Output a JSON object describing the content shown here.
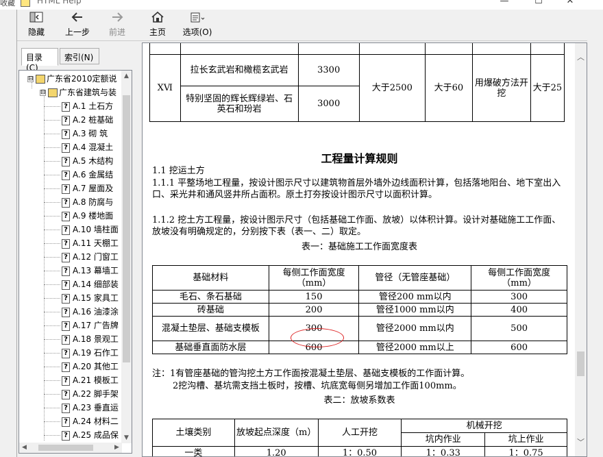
{
  "titlebar": {
    "left_clip": "收藏",
    "title": "HTML Help",
    "minimize": "—",
    "maximize": "☐",
    "close": "✕"
  },
  "toolbar": {
    "hide": {
      "label": "隐藏",
      "icon": "hide-icon"
    },
    "back": {
      "label": "上一步",
      "icon": "back-arrow-icon"
    },
    "forward": {
      "label": "前进",
      "icon": "forward-arrow-icon"
    },
    "home": {
      "label": "主页",
      "icon": "home-icon"
    },
    "options": {
      "label": "选项(O)",
      "icon": "options-icon"
    }
  },
  "nav": {
    "tabs": [
      {
        "label": "目录(C)",
        "active": true
      },
      {
        "label": "索引(N)",
        "active": false
      }
    ],
    "tree": [
      {
        "level": 0,
        "type": "book",
        "expander": "⊟",
        "label": "广东省2010定额说"
      },
      {
        "level": 1,
        "type": "book",
        "expander": "⊟",
        "label": "广东省建筑与装"
      },
      {
        "level": 2,
        "type": "page",
        "label": "A.1 土石方"
      },
      {
        "level": 2,
        "type": "page",
        "label": "A.2 桩基础"
      },
      {
        "level": 2,
        "type": "page",
        "label": "A.3 砌 筑"
      },
      {
        "level": 2,
        "type": "page",
        "label": "A.4 混凝土"
      },
      {
        "level": 2,
        "type": "page",
        "label": "A.5 木结构"
      },
      {
        "level": 2,
        "type": "page",
        "label": "A.6 金属结"
      },
      {
        "level": 2,
        "type": "page",
        "label": "A.7 屋面及"
      },
      {
        "level": 2,
        "type": "page",
        "label": "A.8 防腐与"
      },
      {
        "level": 2,
        "type": "page",
        "label": "A.9 楼地面"
      },
      {
        "level": 2,
        "type": "page",
        "label": "A.10 墙柱面"
      },
      {
        "level": 2,
        "type": "page",
        "label": "A.11 天棚工"
      },
      {
        "level": 2,
        "type": "page",
        "label": "A.12 门窗工"
      },
      {
        "level": 2,
        "type": "page",
        "label": "A.13 幕墙工"
      },
      {
        "level": 2,
        "type": "page",
        "label": "A.14 细部装"
      },
      {
        "level": 2,
        "type": "page",
        "label": "A.15 家具工"
      },
      {
        "level": 2,
        "type": "page",
        "label": "A.16 油漆涂"
      },
      {
        "level": 2,
        "type": "page",
        "label": "A.17 广告牌"
      },
      {
        "level": 2,
        "type": "page",
        "label": "A.18 景观工"
      },
      {
        "level": 2,
        "type": "page",
        "label": "A.19 石作工"
      },
      {
        "level": 2,
        "type": "page",
        "label": "A.20 其他工"
      },
      {
        "level": 2,
        "type": "page",
        "label": "A.21 模板工"
      },
      {
        "level": 2,
        "type": "page",
        "label": "A.22 脚手架"
      },
      {
        "level": 2,
        "type": "page",
        "label": "A.23 垂直运"
      },
      {
        "level": 2,
        "type": "page",
        "label": "A.24 材料二"
      },
      {
        "level": 2,
        "type": "page",
        "label": "A.25 成品保"
      }
    ]
  },
  "content": {
    "top_table": {
      "roman": "ⅩⅥ",
      "rows": [
        {
          "rock": "拉长玄武岩和橄榄玄武岩",
          "value": "3300"
        },
        {
          "rock": "特别坚固的辉长辉绿岩、石英石和玢岩",
          "value": "3000"
        }
      ],
      "col_4": "大于2500",
      "col_5": "大于60",
      "col_6": "用爆破方法开挖",
      "col_7": "大于25"
    },
    "heading": "工程量计算规则",
    "para_1_1": "1.1  挖运土方",
    "para_1_1_1": "1.1.1  平整场地工程量，按设计图示尺寸以建筑物首层外墙外边线面积计算，包括落地阳台、地下室出入口、采光井和通风竖井所占面积。原土打夯按设计图示尺寸以面积计算。",
    "para_1_1_2": "1.1.2  挖土方工程量，按设计图示尺寸（包括基础工作面、放坡）以体积计算。设计对基础施工工作面、放坡没有明确规定的，分别按下表（表一、二）取定。",
    "table1": {
      "caption": "表一：基础施工工作面宽度表",
      "headers": [
        "基础材料",
        "每侧工作面宽度（mm）",
        "管径（无管座基础）",
        "每侧工作面宽度（mm）"
      ],
      "rows": [
        [
          "毛石、条石基础",
          "150",
          "管径200 mm以内",
          "300"
        ],
        [
          "砖基础",
          "200",
          "管径1000 mm以内",
          "400"
        ],
        [
          "混凝土垫层、基础支模板",
          "300",
          "管径2000 mm以内",
          "500"
        ],
        [
          "基础垂直面防水层",
          "600",
          "管径2000 mm以上",
          "600"
        ]
      ]
    },
    "note_1": "注：1有管座基础的管沟挖土方工作面按混凝土垫层、基础支模板的工作面计算。",
    "note_2": "2挖沟槽、基坑需支挡土板时，按槽、坑底宽每侧另增加工作面100mm。",
    "table2": {
      "caption": "表二：放坡系数表",
      "headers": [
        "土壤类别",
        "放坡起点深度（m）",
        "人工开挖",
        "机械开挖",
        "坑内作业",
        "坑上作业"
      ],
      "partial_row": [
        "一类",
        "1.20",
        "1：0.50",
        "1：0.33",
        "1：0.75"
      ]
    }
  }
}
